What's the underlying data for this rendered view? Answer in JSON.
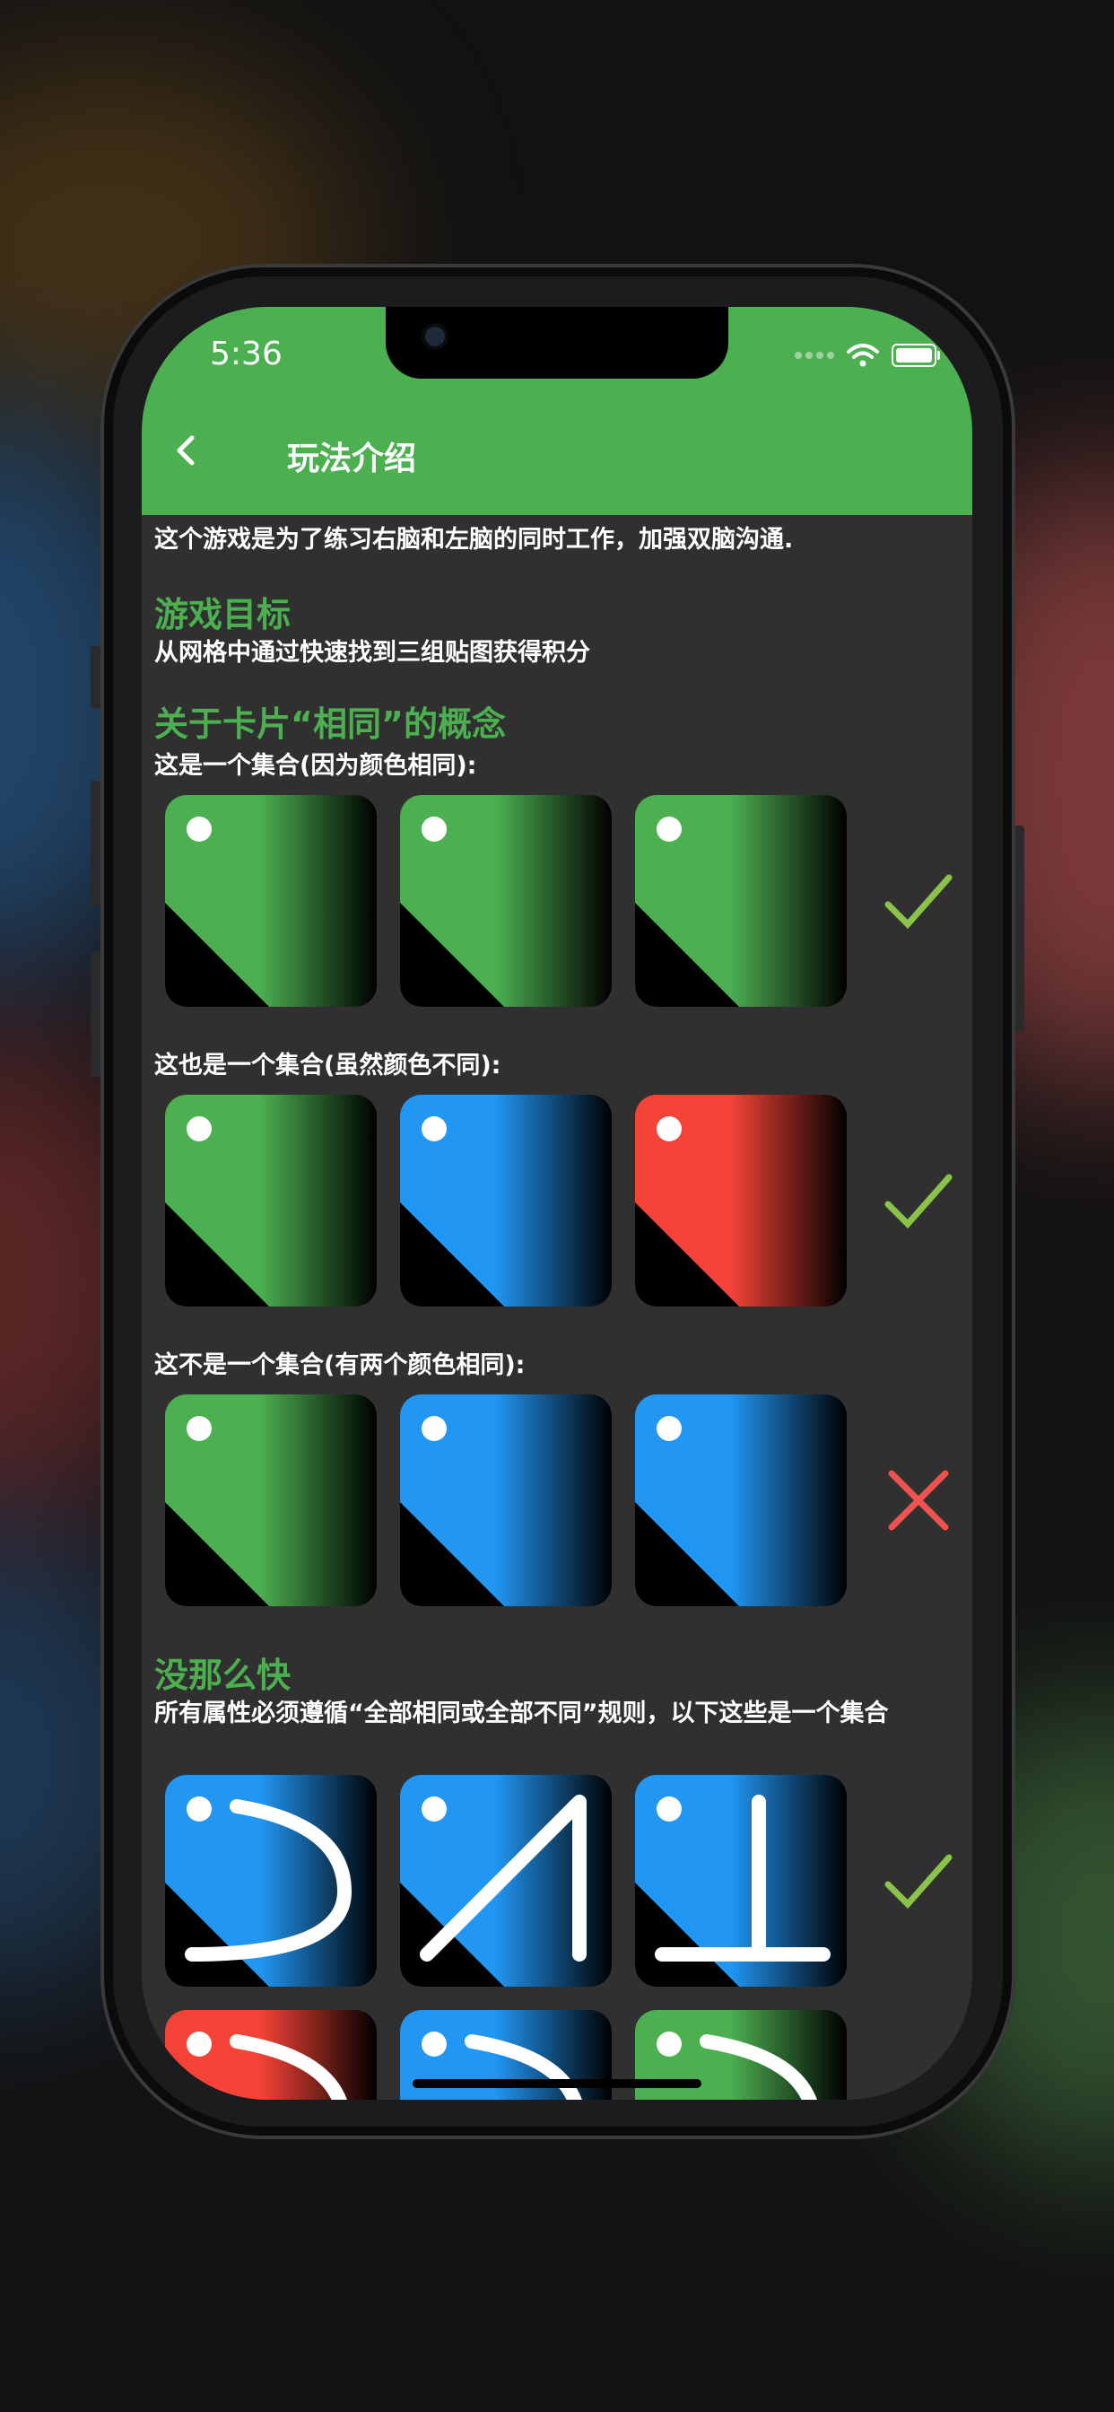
{
  "status": {
    "time": "5:36"
  },
  "header": {
    "title": "玩法介绍",
    "back_icon": "chevron-left-icon"
  },
  "content": {
    "intro": "这个游戏是为了练习右脑和左脑的同时工作，加强双脑沟通.",
    "goal_heading": "游戏目标",
    "goal_text": "从网格中通过快速找到三组贴图获得积分",
    "concept_heading": "关于卡片“相同”的概念",
    "example1_caption": "这是一个集合(因为颜色相同):",
    "example2_caption": "这也是一个集合(虽然颜色不同):",
    "example3_caption": "这不是一个集合(有两个颜色相同):",
    "notfast_heading": "没那么快",
    "notfast_text": "所有属性必须遵循“全部相同或全部不同”规则，以下这些是一个集合"
  },
  "examples": [
    {
      "cards": [
        "green",
        "green",
        "green"
      ],
      "result": "check-icon"
    },
    {
      "cards": [
        "green",
        "blue",
        "red"
      ],
      "result": "check-icon"
    },
    {
      "cards": [
        "green",
        "blue",
        "blue"
      ],
      "result": "cross-icon"
    },
    {
      "cards": [
        "blue",
        "blue",
        "blue"
      ],
      "symbols": [
        "curve",
        "zigzag",
        "inverted-t"
      ],
      "result": "check-icon"
    },
    {
      "cards": [
        "red",
        "blue",
        "green"
      ],
      "symbols": [
        "curve",
        "curve",
        "curve"
      ]
    }
  ],
  "colors": {
    "green": "#4caf50",
    "blue": "#2196f3",
    "red": "#f44336",
    "check": "#8bc34a",
    "cross": "#ef5350",
    "background": "#303030"
  }
}
